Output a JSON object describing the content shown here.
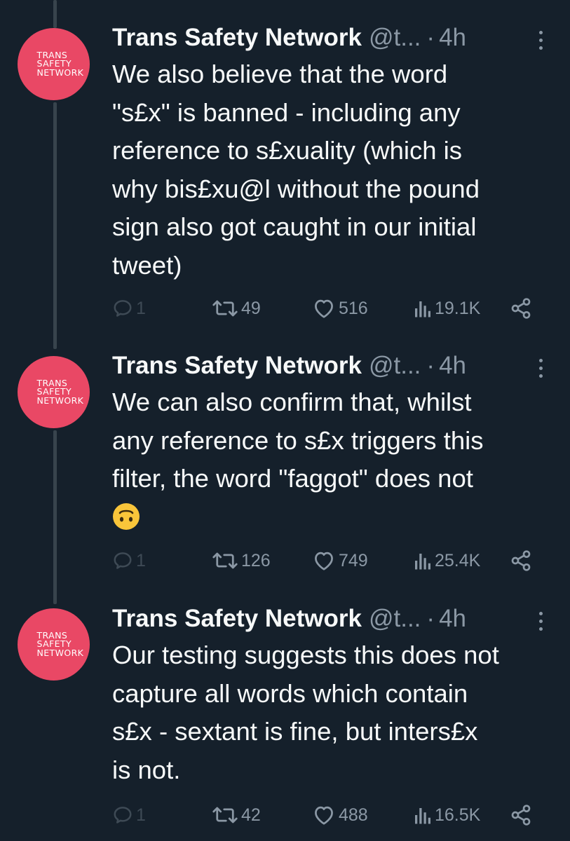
{
  "tweets": [
    {
      "avatar_text": "TRANS\nSAFETY\nNETWORK",
      "name": "Trans Safety Network",
      "handle": "@t...",
      "separator": "·",
      "time": "4h",
      "text": "We also believe that the word\n\"s£x\" is banned - including any\nreference to s£xuality (which is\nwhy bis£xu@l without the pound\nsign also got caught in our initial\ntweet)",
      "emoji": "",
      "replies": "1",
      "retweets": "49",
      "likes": "516",
      "views": "19.1K"
    },
    {
      "avatar_text": "TRANS\nSAFETY\nNETWORK",
      "name": "Trans Safety Network",
      "handle": "@t...",
      "separator": "·",
      "time": "4h",
      "text": "We can also confirm that, whilst\nany reference to s£x triggers this\nfilter, the word \"faggot\" does not\n",
      "emoji": "upside-down-face",
      "replies": "1",
      "retweets": "126",
      "likes": "749",
      "views": "25.4K"
    },
    {
      "avatar_text": "TRANS\nSAFETY\nNETWORK",
      "name": "Trans Safety Network",
      "handle": "@t...",
      "separator": "·",
      "time": "4h",
      "text": "Our testing suggests this does not\ncapture all words which contain\ns£x - sextant is fine, but inters£x\nis not.",
      "emoji": "",
      "replies": "1",
      "retweets": "42",
      "likes": "488",
      "views": "16.5K"
    }
  ],
  "colors": {
    "background": "#15202b",
    "avatar": "#e94865",
    "text": "#f7f9f9",
    "secondary_text": "#8b98a5",
    "thread_line": "#38444d",
    "emoji": "#f9c53a"
  },
  "icons": {
    "reply": "reply-icon",
    "retweet": "retweet-icon",
    "like": "heart-icon",
    "views": "views-icon",
    "share": "share-icon",
    "more": "more-icon"
  }
}
